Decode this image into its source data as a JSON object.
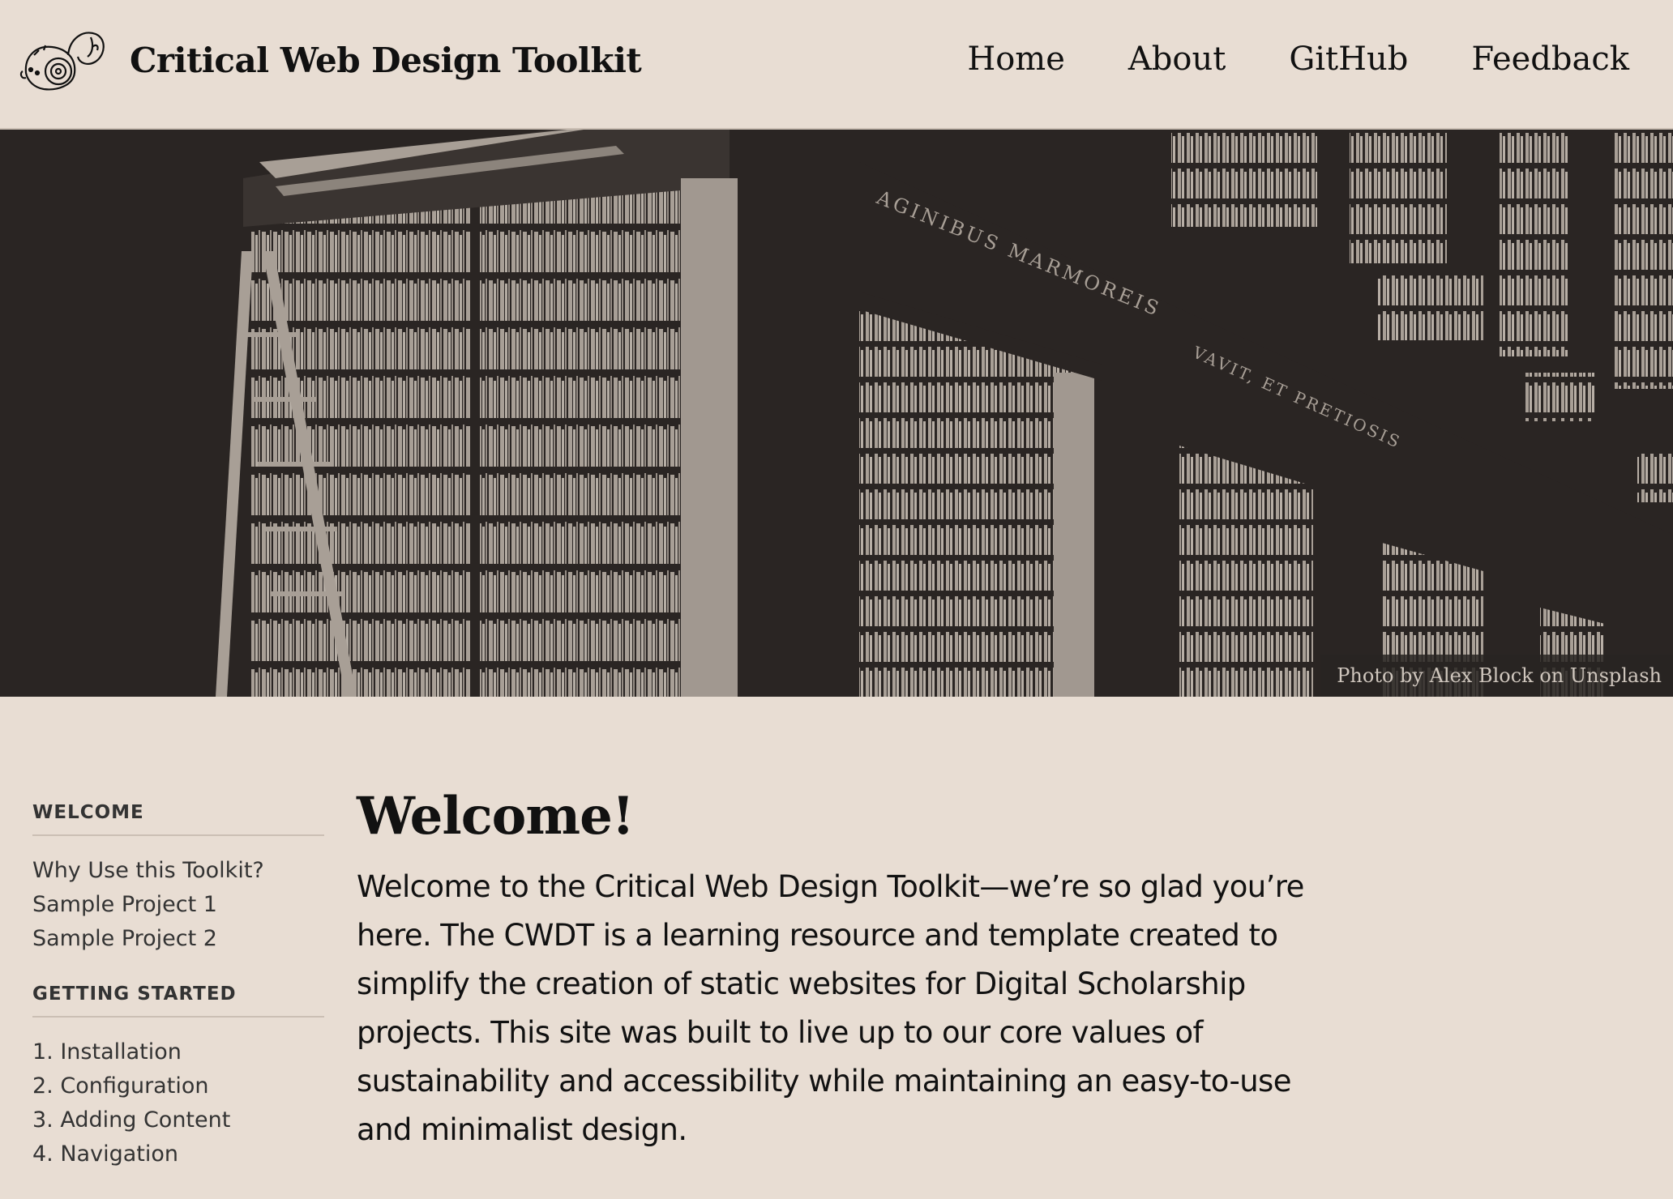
{
  "header": {
    "site_title": "Critical Web Design Toolkit",
    "nav": [
      "Home",
      "About",
      "GitHub",
      "Feedback"
    ]
  },
  "hero": {
    "photo_credit": "Photo by Alex Block on Unsplash",
    "inscription_1": "AGINIBUS MARMOREIS",
    "inscription_2": "VAVIT, ET PRETIOSIS"
  },
  "sidebar": {
    "sections": [
      {
        "title": "WELCOME",
        "items": [
          "Why Use this Toolkit?",
          "Sample Project 1",
          "Sample Project 2"
        ]
      },
      {
        "title": "GETTING STARTED",
        "items": [
          "1. Installation",
          "2. Configuration",
          "3. Adding Content",
          "4. Navigation"
        ]
      }
    ]
  },
  "main": {
    "title": "Welcome!",
    "intro": "Welcome to the Critical Web Design Toolkit—we’re so glad you’re here. The CWDT is a learning resource and template created to simplify the creation of static websites for Digital Scholarship projects. This site was built to live up to our core values of sustainability and accessibility while maintaining an easy-to-use and minimalist design."
  },
  "colors": {
    "background": "#e8ddd3",
    "hero_dark": "#2a2523",
    "hero_light": "#a89f96",
    "text": "#111111"
  }
}
